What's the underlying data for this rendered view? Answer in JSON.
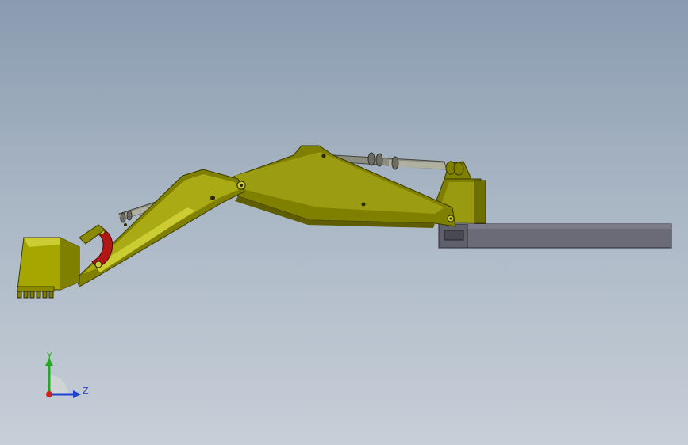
{
  "viewport": {
    "background_top": "#8a9bb0",
    "background_bottom": "#c7cfd8"
  },
  "model": {
    "arm_color": "#7f7f00",
    "arm_highlight": "#a6a600",
    "arm_light": "#cccc33",
    "link_color": "#b01818",
    "cylinder_color": "#8c8c80",
    "base_color": "#6a6a76"
  },
  "triad": {
    "y_label": "Y",
    "z_label": "Z",
    "y_color": "#22aa22",
    "z_color": "#2244cc",
    "x_color": "#cc2222"
  }
}
